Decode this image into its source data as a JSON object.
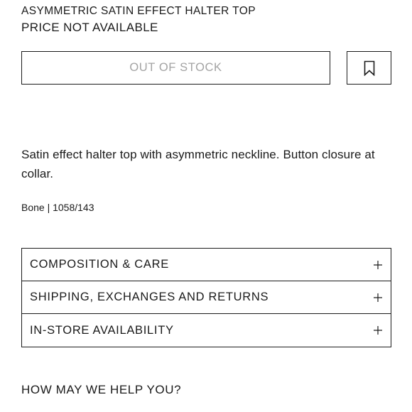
{
  "product": {
    "name": "ASYMMETRIC SATIN EFFECT HALTER TOP",
    "price": "PRICE NOT AVAILABLE",
    "description": "Satin effect halter top with asymmetric neckline. Button closure at collar.",
    "reference": "Bone | 1058/143"
  },
  "actions": {
    "stock_label": "OUT OF STOCK",
    "bookmark_icon": "bookmark-icon"
  },
  "accordion": {
    "items": [
      {
        "label": "COMPOSITION & CARE",
        "icon": "plus-icon"
      },
      {
        "label": "SHIPPING, EXCHANGES AND RETURNS",
        "icon": "plus-icon"
      },
      {
        "label": "IN-STORE AVAILABILITY",
        "icon": "plus-icon"
      }
    ]
  },
  "help": {
    "title": "HOW MAY WE HELP YOU?"
  },
  "colors": {
    "text": "#1a1a1a",
    "disabled_text": "#a3a3a3",
    "border": "#1a1a1a",
    "background": "#ffffff"
  }
}
